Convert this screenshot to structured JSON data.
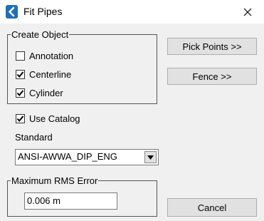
{
  "window": {
    "title": "Fit Pipes",
    "app_icon": "chevron-left-badge-icon",
    "close_icon": "close-icon"
  },
  "create_object": {
    "legend": "Create Object",
    "options": [
      {
        "label": "Annotation",
        "checked": false
      },
      {
        "label": "Centerline",
        "checked": true
      },
      {
        "label": "Cylinder",
        "checked": true
      }
    ]
  },
  "buttons": {
    "pick_points": "Pick Points >>",
    "fence": "Fence >>",
    "cancel": "Cancel"
  },
  "use_catalog": {
    "label": "Use Catalog",
    "checked": true
  },
  "standard": {
    "label": "Standard",
    "selected": "ANSI-AWWA_DIP_ENG",
    "arrow_icon": "dropdown-arrow-icon"
  },
  "rms": {
    "legend": "Maximum RMS Error",
    "value": "0.006 m"
  },
  "colors": {
    "title_bar": "#ffffff",
    "dialog_bg": "#f0f0f0",
    "app_icon": "#1f6fb5",
    "button_bg": "#e1e1e1"
  }
}
